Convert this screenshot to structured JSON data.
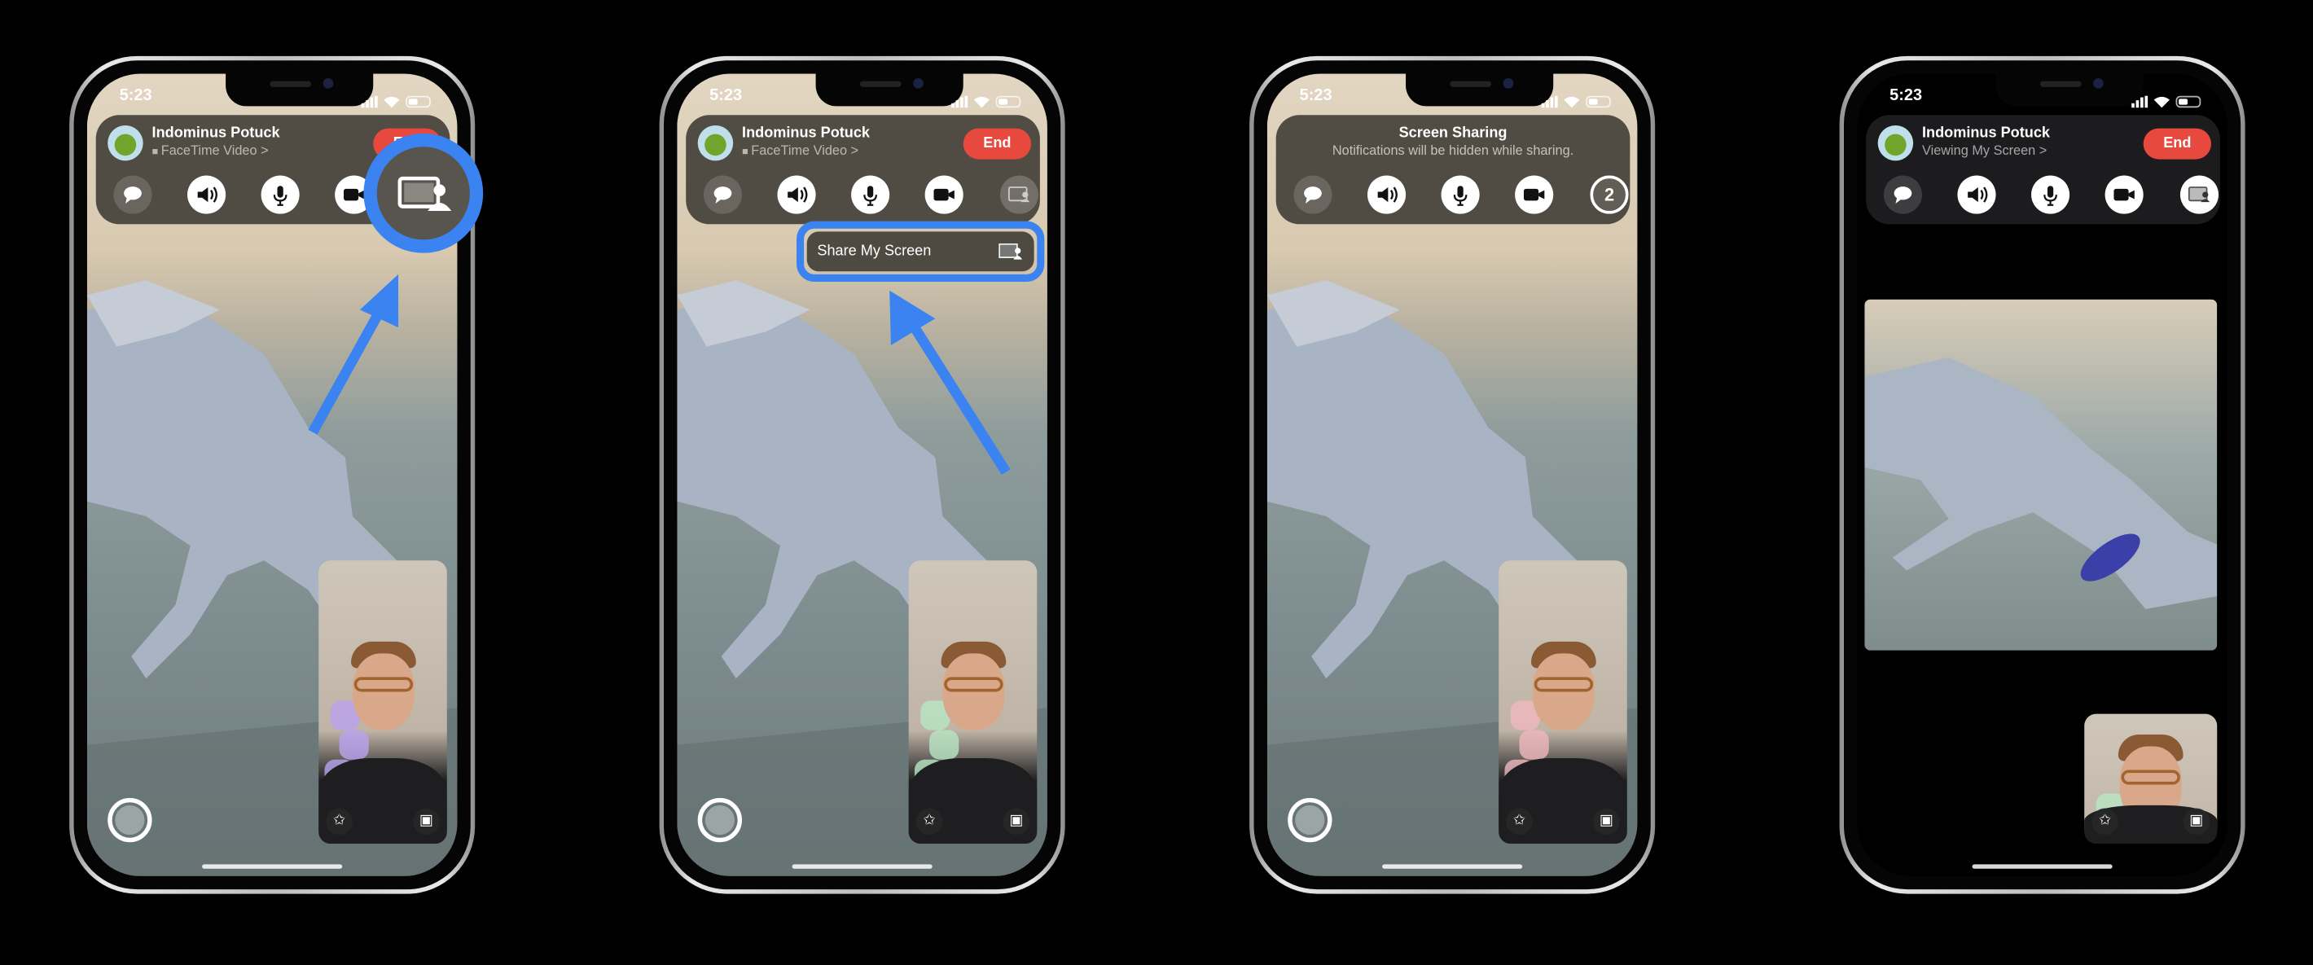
{
  "colors": {
    "annotation_blue": "#3a83f1",
    "end_red": "#e8493e",
    "panel_grey": "#46423a",
    "panel_dark": "#1c1c1e"
  },
  "phones": [
    {
      "status_time": "5:23",
      "background": "dinosaur-video",
      "panel": {
        "type": "caller",
        "name": "Indominus Potuck",
        "subtitle": "FaceTime Video >",
        "subtitle_icon": "video-icon",
        "end_label": "End"
      },
      "controls": [
        "chat-icon",
        "speaker-icon",
        "microphone-icon",
        "camera-icon",
        "share-screen-icon"
      ],
      "share_highlighted": true,
      "self_view_icons": [
        "effects-star-icon",
        "flip-camera-icon"
      ],
      "shutter": true
    },
    {
      "status_time": "5:23",
      "background": "dinosaur-video",
      "panel": {
        "type": "caller",
        "name": "Indominus Potuck",
        "subtitle": "FaceTime Video >",
        "subtitle_icon": "video-icon",
        "end_label": "End"
      },
      "controls": [
        "chat-icon",
        "speaker-icon",
        "microphone-icon",
        "camera-icon",
        "share-screen-icon"
      ],
      "menu": {
        "label": "Share My Screen",
        "icon": "share-screen-icon"
      },
      "self_view_icons": [
        "effects-star-icon",
        "flip-camera-icon"
      ],
      "shutter": true
    },
    {
      "status_time": "5:23",
      "background": "dinosaur-video",
      "panel": {
        "type": "notice",
        "title": "Screen Sharing",
        "message": "Notifications will be hidden while sharing."
      },
      "controls": [
        "chat-icon",
        "speaker-icon",
        "microphone-icon",
        "camera-icon",
        "countdown"
      ],
      "countdown": "2",
      "self_view_icons": [
        "effects-star-icon",
        "flip-camera-icon"
      ],
      "shutter": true
    },
    {
      "status_time": "5:23",
      "background": "black",
      "panel": {
        "type": "caller",
        "name": "Indominus Potuck",
        "subtitle": "Viewing My Screen >",
        "end_label": "End"
      },
      "controls": [
        "chat-icon",
        "speaker-icon",
        "microphone-icon",
        "camera-icon",
        "share-screen-icon"
      ],
      "shared_preview": true,
      "self_view_icons": [
        "effects-star-icon",
        "flip-camera-icon"
      ],
      "shutter": false
    }
  ]
}
